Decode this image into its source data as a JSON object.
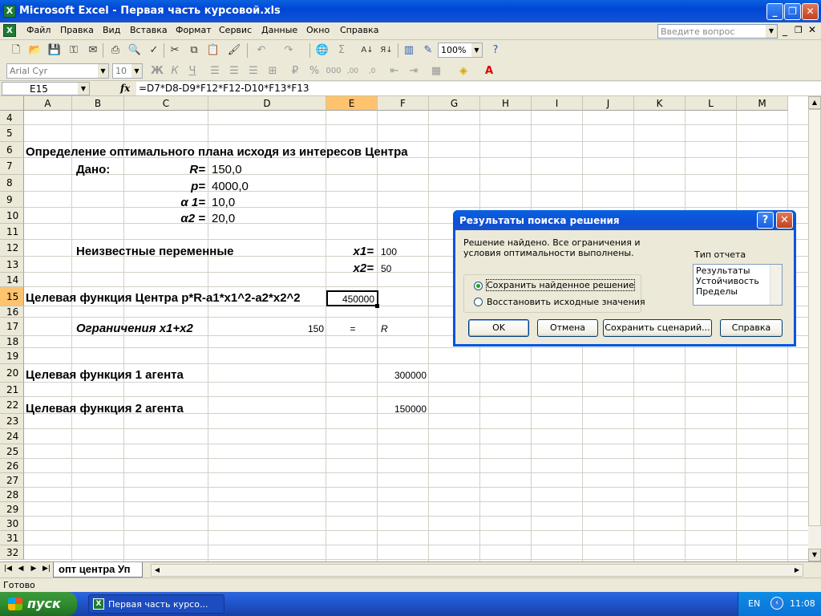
{
  "window": {
    "title": "Microsoft Excel - Первая часть курсовой.xls"
  },
  "menu": [
    "Файл",
    "Правка",
    "Вид",
    "Вставка",
    "Формат",
    "Сервис",
    "Данные",
    "Окно",
    "Справка"
  ],
  "help_search": {
    "placeholder": "Введите вопрос"
  },
  "toolbar": {
    "zoom": "100%",
    "font_name": "Arial Cyr",
    "font_size": "10"
  },
  "formula_bar": {
    "cell_ref": "E15",
    "fx": "fx",
    "formula": "=D7*D8-D9*F12*F12-D10*F13*F13"
  },
  "columns": [
    "A",
    "B",
    "C",
    "D",
    "E",
    "F",
    "G",
    "H",
    "I",
    "J",
    "K",
    "L",
    "M"
  ],
  "rows": [
    "4",
    "5",
    "6",
    "7",
    "8",
    "9",
    "10",
    "11",
    "12",
    "13",
    "14",
    "15",
    "16",
    "17",
    "18",
    "19",
    "20",
    "21",
    "22",
    "23",
    "24",
    "25",
    "26",
    "27",
    "28",
    "29",
    "30",
    "31",
    "32"
  ],
  "cells": {
    "a6": "Определение оптимального плана исходя из интересов Центра",
    "b7": "Дано:",
    "c7": "R=",
    "d7": "150,0",
    "c8": "p=",
    "d8": "4000,0",
    "c9": "α 1=",
    "d9": "10,0",
    "c10": "α2 =",
    "d10": "20,0",
    "b12": "Неизвестные переменные",
    "e12": "x1=",
    "f12": "100",
    "e13": "x2=",
    "f13": "50",
    "a15": "Целевая функция Центра p*R-a1*x1^2-a2*x2^2",
    "e15": "450000",
    "b17": "Ограничения x1+x2",
    "d17": "150",
    "e17": "=",
    "f17": "R",
    "a20": "Целевая функция 1 агента",
    "f20": "300000",
    "a22": "Целевая функция 2 агента",
    "f22": "150000"
  },
  "sheet_tab": "опт центра Уп",
  "status": "Готово",
  "taskbar": {
    "start": "пуск",
    "task": "Первая часть курсо...",
    "lang": "EN",
    "clock": "11:08"
  },
  "dialog": {
    "title": "Результаты поиска решения",
    "message": "Решение найдено. Все ограничения и условия оптимальности выполнены.",
    "option_keep": "Сохранить найденное решение",
    "option_restore": "Восстановить исходные значения",
    "report_type_label": "Тип отчета",
    "reports": [
      "Результаты",
      "Устойчивость",
      "Пределы"
    ],
    "ok": "OK",
    "cancel": "Отмена",
    "save_scenario": "Сохранить сценарий...",
    "help": "Справка"
  }
}
